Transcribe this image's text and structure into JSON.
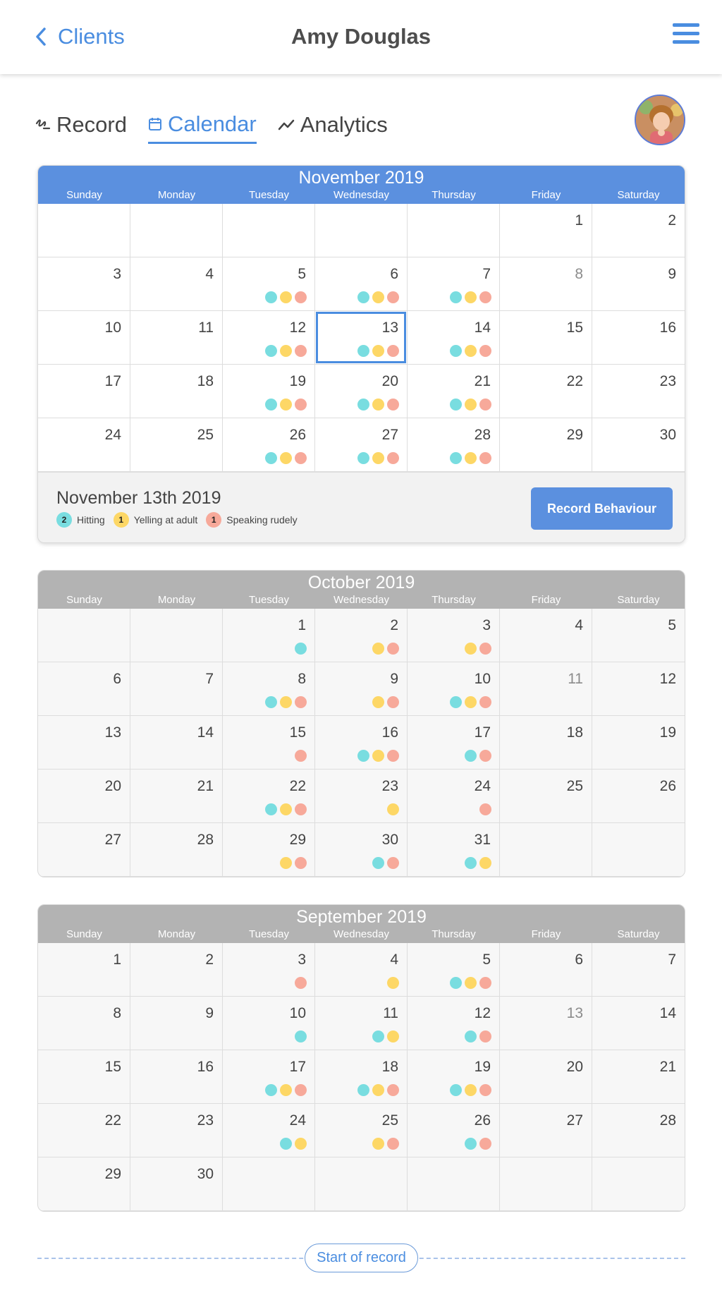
{
  "header": {
    "back_label": "Clients",
    "title": "Amy Douglas"
  },
  "tabs": [
    {
      "label": "Record",
      "icon": "pen-icon",
      "active": false
    },
    {
      "label": "Calendar",
      "icon": "calendar-icon",
      "active": true
    },
    {
      "label": "Analytics",
      "icon": "trend-line-icon",
      "active": false
    }
  ],
  "colors": {
    "accent": "#4a8de0",
    "hitting": "#79dde0",
    "yelling": "#fdd766",
    "speaking": "#f7a99a",
    "current_header": "#5b90df",
    "past_header": "#b3b3b3"
  },
  "weekdays": [
    "Sunday",
    "Monday",
    "Tuesday",
    "Wednesday",
    "Thursday",
    "Friday",
    "Saturday"
  ],
  "calendars": [
    {
      "month": "November 2019",
      "current": true,
      "header_color": "#5b90df",
      "days": [
        {},
        {},
        {},
        {},
        {},
        {
          "n": "1"
        },
        {
          "n": "2"
        },
        {
          "n": "3"
        },
        {
          "n": "4"
        },
        {
          "n": "5",
          "d": [
            "h",
            "y",
            "s"
          ]
        },
        {
          "n": "6",
          "d": [
            "h",
            "y",
            "s"
          ]
        },
        {
          "n": "7",
          "d": [
            "h",
            "y",
            "s"
          ]
        },
        {
          "n": "8",
          "muted": true
        },
        {
          "n": "9"
        },
        {
          "n": "10"
        },
        {
          "n": "11"
        },
        {
          "n": "12",
          "d": [
            "h",
            "y",
            "s"
          ]
        },
        {
          "n": "13",
          "d": [
            "h",
            "y",
            "s"
          ],
          "selected": true
        },
        {
          "n": "14",
          "d": [
            "h",
            "y",
            "s"
          ]
        },
        {
          "n": "15"
        },
        {
          "n": "16"
        },
        {
          "n": "17"
        },
        {
          "n": "18"
        },
        {
          "n": "19",
          "d": [
            "h",
            "y",
            "s"
          ]
        },
        {
          "n": "20",
          "d": [
            "h",
            "y",
            "s"
          ]
        },
        {
          "n": "21",
          "d": [
            "h",
            "y",
            "s"
          ]
        },
        {
          "n": "22"
        },
        {
          "n": "23"
        },
        {
          "n": "24"
        },
        {
          "n": "25"
        },
        {
          "n": "26",
          "d": [
            "h",
            "y",
            "s"
          ]
        },
        {
          "n": "27",
          "d": [
            "h",
            "y",
            "s"
          ]
        },
        {
          "n": "28",
          "d": [
            "h",
            "y",
            "s"
          ]
        },
        {
          "n": "29"
        },
        {
          "n": "30"
        }
      ]
    },
    {
      "month": "October 2019",
      "current": false,
      "header_color": "#b3b3b3",
      "days": [
        {},
        {},
        {
          "n": "1",
          "d": [
            "h"
          ]
        },
        {
          "n": "2",
          "d": [
            "y",
            "s"
          ]
        },
        {
          "n": "3",
          "d": [
            "y",
            "s"
          ]
        },
        {
          "n": "4"
        },
        {
          "n": "5"
        },
        {
          "n": "6"
        },
        {
          "n": "7"
        },
        {
          "n": "8",
          "d": [
            "h",
            "y",
            "s"
          ]
        },
        {
          "n": "9",
          "d": [
            "y",
            "s"
          ]
        },
        {
          "n": "10",
          "d": [
            "h",
            "y",
            "s"
          ]
        },
        {
          "n": "11",
          "muted": true
        },
        {
          "n": "12"
        },
        {
          "n": "13"
        },
        {
          "n": "14"
        },
        {
          "n": "15",
          "d": [
            "s"
          ]
        },
        {
          "n": "16",
          "d": [
            "h",
            "y",
            "s"
          ]
        },
        {
          "n": "17",
          "d": [
            "h",
            "s"
          ]
        },
        {
          "n": "18"
        },
        {
          "n": "19"
        },
        {
          "n": "20"
        },
        {
          "n": "21"
        },
        {
          "n": "22",
          "d": [
            "h",
            "y",
            "s"
          ]
        },
        {
          "n": "23",
          "d": [
            "y"
          ]
        },
        {
          "n": "24",
          "d": [
            "s"
          ]
        },
        {
          "n": "25"
        },
        {
          "n": "26"
        },
        {
          "n": "27"
        },
        {
          "n": "28"
        },
        {
          "n": "29",
          "d": [
            "y",
            "s"
          ]
        },
        {
          "n": "30",
          "d": [
            "h",
            "s"
          ]
        },
        {
          "n": "31",
          "d": [
            "h",
            "y"
          ]
        },
        {},
        {}
      ]
    },
    {
      "month": "September 2019",
      "current": false,
      "header_color": "#b3b3b3",
      "days": [
        {
          "n": "1"
        },
        {
          "n": "2"
        },
        {
          "n": "3",
          "d": [
            "s"
          ]
        },
        {
          "n": "4",
          "d": [
            "y"
          ]
        },
        {
          "n": "5",
          "d": [
            "h",
            "y",
            "s"
          ]
        },
        {
          "n": "6"
        },
        {
          "n": "7"
        },
        {
          "n": "8"
        },
        {
          "n": "9"
        },
        {
          "n": "10",
          "d": [
            "h"
          ]
        },
        {
          "n": "11",
          "d": [
            "h",
            "y"
          ]
        },
        {
          "n": "12",
          "d": [
            "h",
            "s"
          ]
        },
        {
          "n": "13",
          "muted": true
        },
        {
          "n": "14"
        },
        {
          "n": "15"
        },
        {
          "n": "16"
        },
        {
          "n": "17",
          "d": [
            "h",
            "y",
            "s"
          ]
        },
        {
          "n": "18",
          "d": [
            "h",
            "y",
            "s"
          ]
        },
        {
          "n": "19",
          "d": [
            "h",
            "y",
            "s"
          ]
        },
        {
          "n": "20"
        },
        {
          "n": "21"
        },
        {
          "n": "22"
        },
        {
          "n": "23"
        },
        {
          "n": "24",
          "d": [
            "h",
            "y"
          ]
        },
        {
          "n": "25",
          "d": [
            "y",
            "s"
          ]
        },
        {
          "n": "26",
          "d": [
            "h",
            "s"
          ]
        },
        {
          "n": "27"
        },
        {
          "n": "28"
        },
        {
          "n": "29"
        },
        {
          "n": "30"
        },
        {},
        {},
        {},
        {},
        {}
      ]
    }
  ],
  "selected_panel": {
    "date": "November 13th 2019",
    "legend": [
      {
        "count": "2",
        "label": "Hitting",
        "key": "h"
      },
      {
        "count": "1",
        "label": "Yelling at adult",
        "key": "y"
      },
      {
        "count": "1",
        "label": "Speaking rudely",
        "key": "s"
      }
    ],
    "button_label": "Record Behaviour"
  },
  "start_of_record_label": "Start of record"
}
